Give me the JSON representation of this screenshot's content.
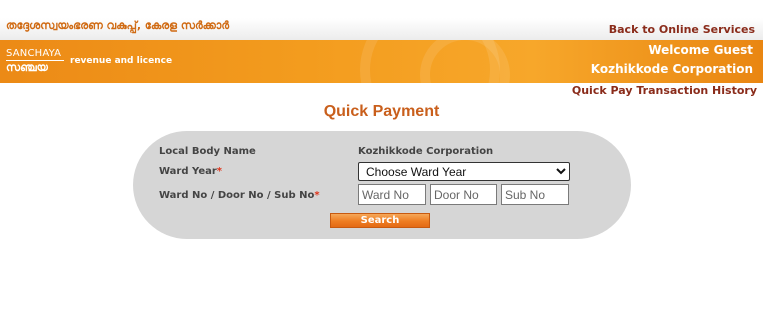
{
  "header": {
    "department_name": "തദ്ദേശസ്വയംഭരണ വകുപ്പ്, കേരള സർക്കാർ",
    "back_link": "Back to Online Services"
  },
  "banner": {
    "logo_top": "SANCHAYA",
    "logo_bottom": "സഞ്ചയ",
    "tagline": "revenue and licence",
    "welcome": "Welcome Guest",
    "organization": "Kozhikkode Corporation"
  },
  "nav": {
    "history_link": "Quick Pay Transaction History"
  },
  "page": {
    "title": "Quick Payment"
  },
  "form": {
    "local_body_label": "Local Body Name",
    "local_body_value": "Kozhikkode Corporation",
    "ward_year_label": "Ward Year",
    "ward_year_selected": "Choose Ward Year",
    "ward_no_label": "Ward No / Door No / Sub No",
    "required_mark": "*",
    "ward_no_placeholder": "Ward No",
    "door_no_placeholder": "Door No",
    "sub_no_placeholder": "Sub No",
    "search_label": "Search"
  },
  "colors": {
    "accent_orange": "#f39c1e",
    "title_orange": "#c95f1c",
    "link_maroon": "#8a2b1a",
    "panel_gray": "#d6d6d6",
    "required_red": "#e0341a"
  }
}
